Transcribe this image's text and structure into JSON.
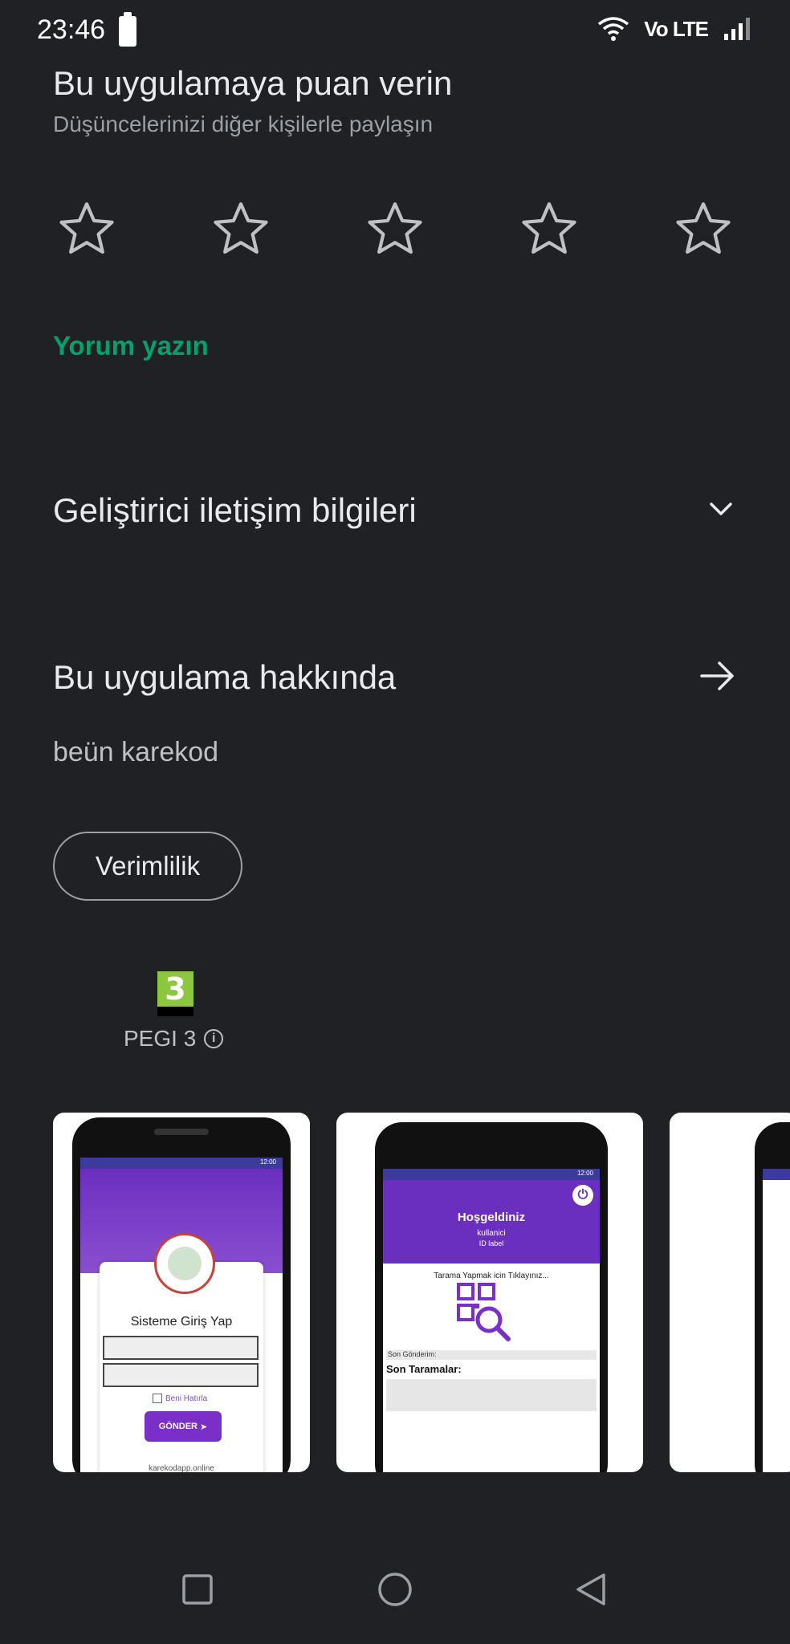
{
  "status_bar": {
    "time": "23:46",
    "network": "Vo LTE"
  },
  "rating": {
    "title": "Bu uygulamaya puan verin",
    "subtitle": "Düşüncelerinizi diğer kişilerle paylaşın",
    "stars": 5,
    "selected": 0
  },
  "write_review_label": "Yorum yazın",
  "developer_contact": {
    "title": "Geliştirici iletişim bilgileri"
  },
  "about": {
    "title": "Bu uygulama hakkında",
    "description": "beün karekod",
    "category_chip": "Verimlilik"
  },
  "content_rating": {
    "badge_number": "3",
    "label": "PEGI 3"
  },
  "screenshots": {
    "shot1": {
      "title": "Sisteme Giriş Yap",
      "remember": "Beni Hatırla",
      "button": "GÖNDER",
      "url": "karekodapp.online",
      "status_time": "12:00"
    },
    "shot2": {
      "welcome": "Hoşgeldiniz",
      "user": "kullanici",
      "id_label": "ID label",
      "scan_prompt": "Tarama Yapmak icin Tıklayınız...",
      "last_sent": "Son Gönderim:",
      "last_scans": "Son Taramalar:",
      "status_time": "12:00"
    }
  },
  "colors": {
    "accent_green": "#01a26b",
    "background": "#202124",
    "app_purple": "#6b2fbf"
  }
}
